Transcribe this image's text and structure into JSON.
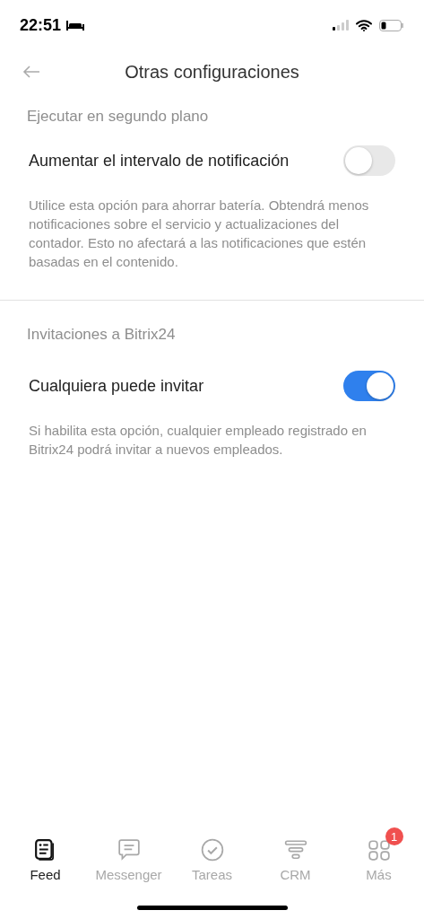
{
  "status_bar": {
    "time": "22:51"
  },
  "header": {
    "title": "Otras configuraciones"
  },
  "sections": [
    {
      "title": "Ejecutar en segundo plano",
      "setting": {
        "label": "Aumentar el intervalo de notificación",
        "on": false
      },
      "description": "Utilice esta opción para ahorrar batería. Obtendrá menos notificaciones sobre el servicio y actualizaciones del contador. Esto no afectará a las notificaciones que estén basadas en el contenido."
    },
    {
      "title": "Invitaciones a Bitrix24",
      "setting": {
        "label": "Cualquiera puede invitar",
        "on": true
      },
      "description": "Si habilita esta opción, cualquier empleado registrado en Bitrix24 podrá invitar a nuevos empleados."
    }
  ],
  "tab_bar": [
    {
      "kind": "feed",
      "label": "Feed",
      "selected": true
    },
    {
      "kind": "messenger",
      "label": "Messenger",
      "selected": false
    },
    {
      "kind": "tasks",
      "label": "Tareas",
      "selected": false
    },
    {
      "kind": "crm",
      "label": "CRM",
      "selected": false
    },
    {
      "kind": "more",
      "label": "Más",
      "selected": false,
      "badge": "1"
    }
  ]
}
